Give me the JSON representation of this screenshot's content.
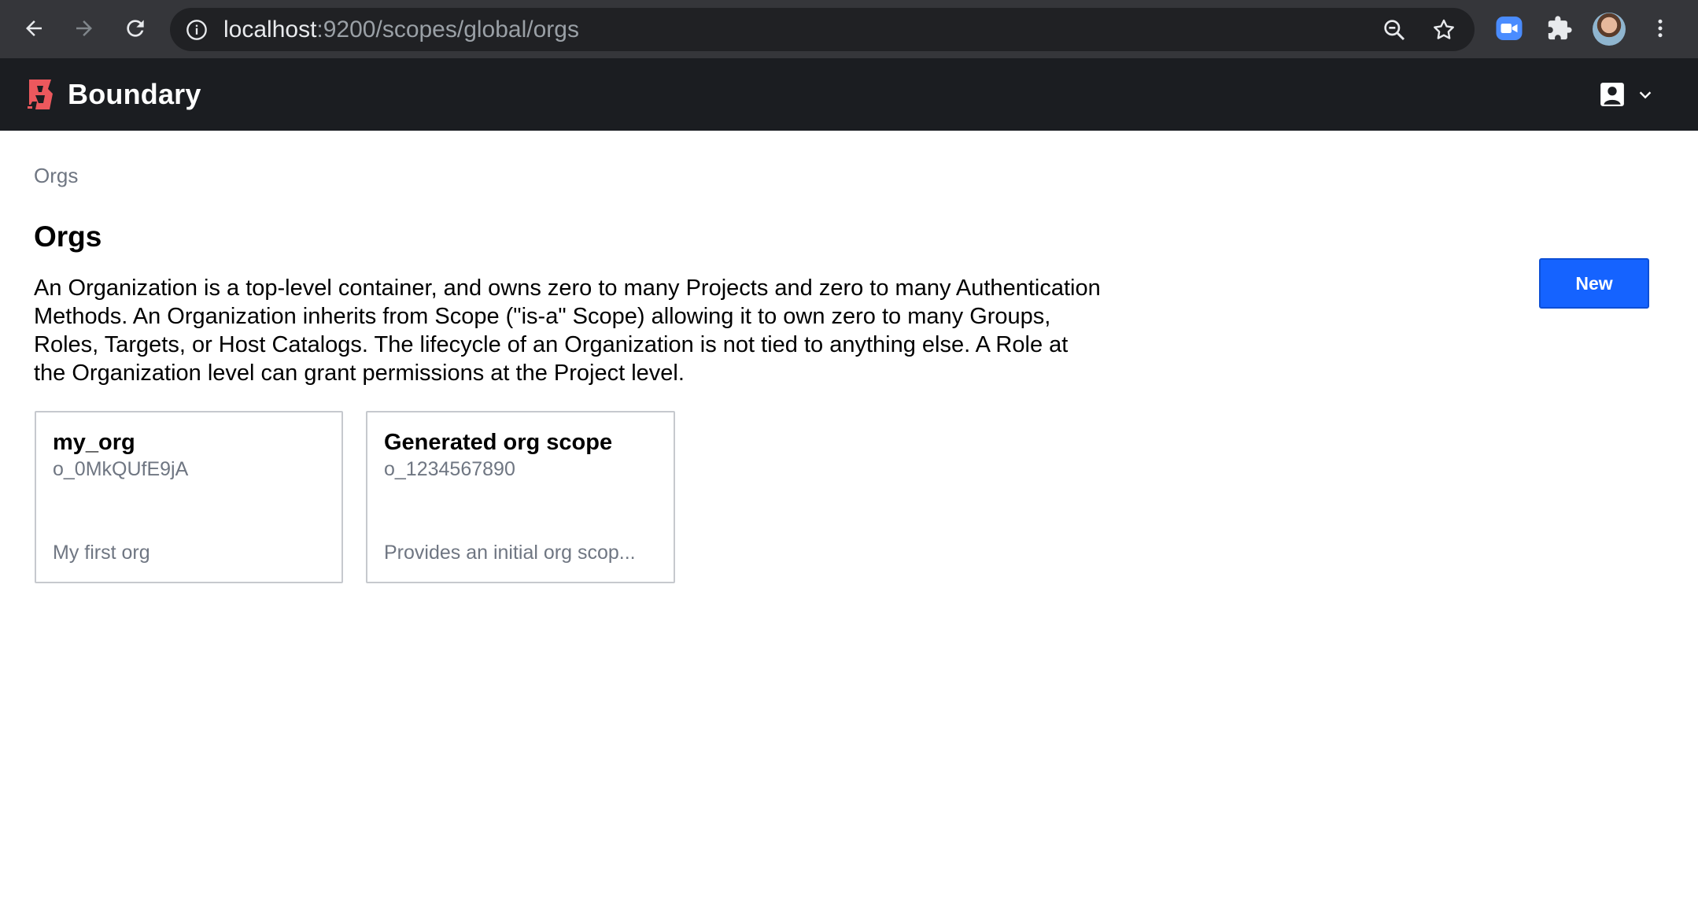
{
  "browser": {
    "url_host": "localhost",
    "url_path": ":9200/scopes/global/orgs",
    "icons": [
      "back-arrow-icon",
      "forward-arrow-icon",
      "reload-icon",
      "info-icon",
      "zoom-icon",
      "star-icon",
      "zoom-extension-icon",
      "puzzle-icon",
      "kebab-menu-icon"
    ]
  },
  "header": {
    "brand": "Boundary",
    "brand_color": "#ec585d",
    "user_icon": "user-account-icon"
  },
  "breadcrumb": "Orgs",
  "page": {
    "title": "Orgs",
    "description": "An Organization is a top-level container, and owns zero to many Projects and zero to many Authentication Methods. An Organization inherits from Scope (\"is-a\" Scope) allowing it to own zero to many Groups, Roles, Targets, or Host Catalogs. The lifecycle of an Organization is not tied to anything else. A Role at the Organization level can grant permissions at the Project level.",
    "new_button": "New",
    "accent_color": "#1563ff"
  },
  "orgs": [
    {
      "name": "my_org",
      "id": "o_0MkQUfE9jA",
      "description": "My first org"
    },
    {
      "name": "Generated org scope",
      "id": "o_1234567890",
      "description": "Provides an initial org scop..."
    }
  ]
}
